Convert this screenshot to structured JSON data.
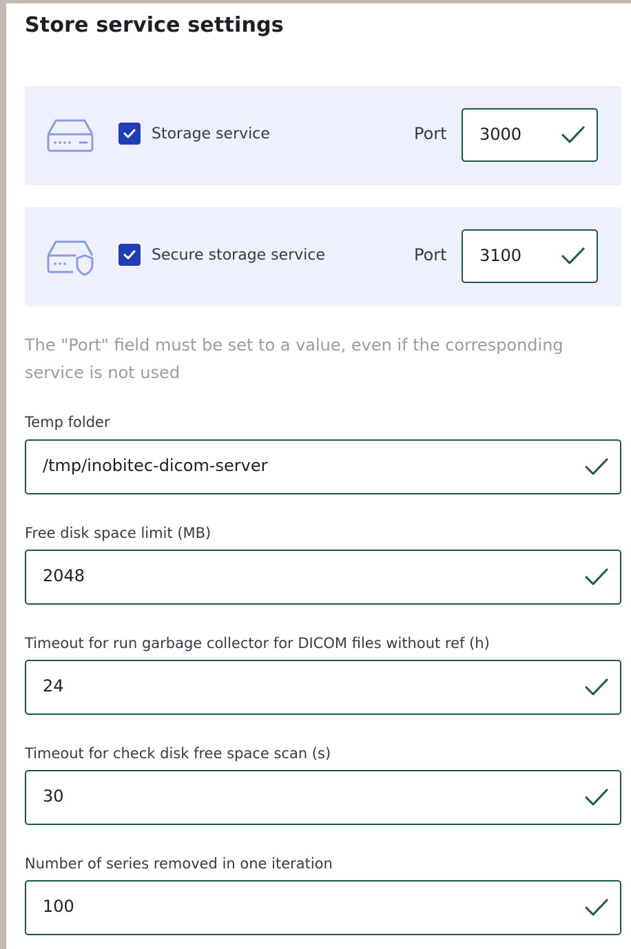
{
  "page": {
    "title": "Store service settings"
  },
  "services": [
    {
      "icon": "server-drive-icon",
      "checked": true,
      "label": "Storage service",
      "port_label": "Port",
      "port_value": "3000"
    },
    {
      "icon": "secure-server-drive-icon",
      "checked": true,
      "label": "Secure storage service",
      "port_label": "Port",
      "port_value": "3100"
    }
  ],
  "hint": "The \"Port\" field must be set to a value, even if the corresponding service is not used",
  "fields": [
    {
      "label": "Temp folder",
      "value": "/tmp/inobitec-dicom-server"
    },
    {
      "label": "Free disk space limit (MB)",
      "value": "2048"
    },
    {
      "label": "Timeout for run garbage collector for DICOM files without ref (h)",
      "value": "24"
    },
    {
      "label": "Timeout for check disk free space scan (s)",
      "value": "30"
    },
    {
      "label": "Number of series removed in one iteration",
      "value": "100"
    }
  ],
  "colors": {
    "accent": "#1f3db5",
    "valid": "#1a5a45",
    "card_bg": "#eef1fd",
    "icon": "#7a8fd8"
  }
}
